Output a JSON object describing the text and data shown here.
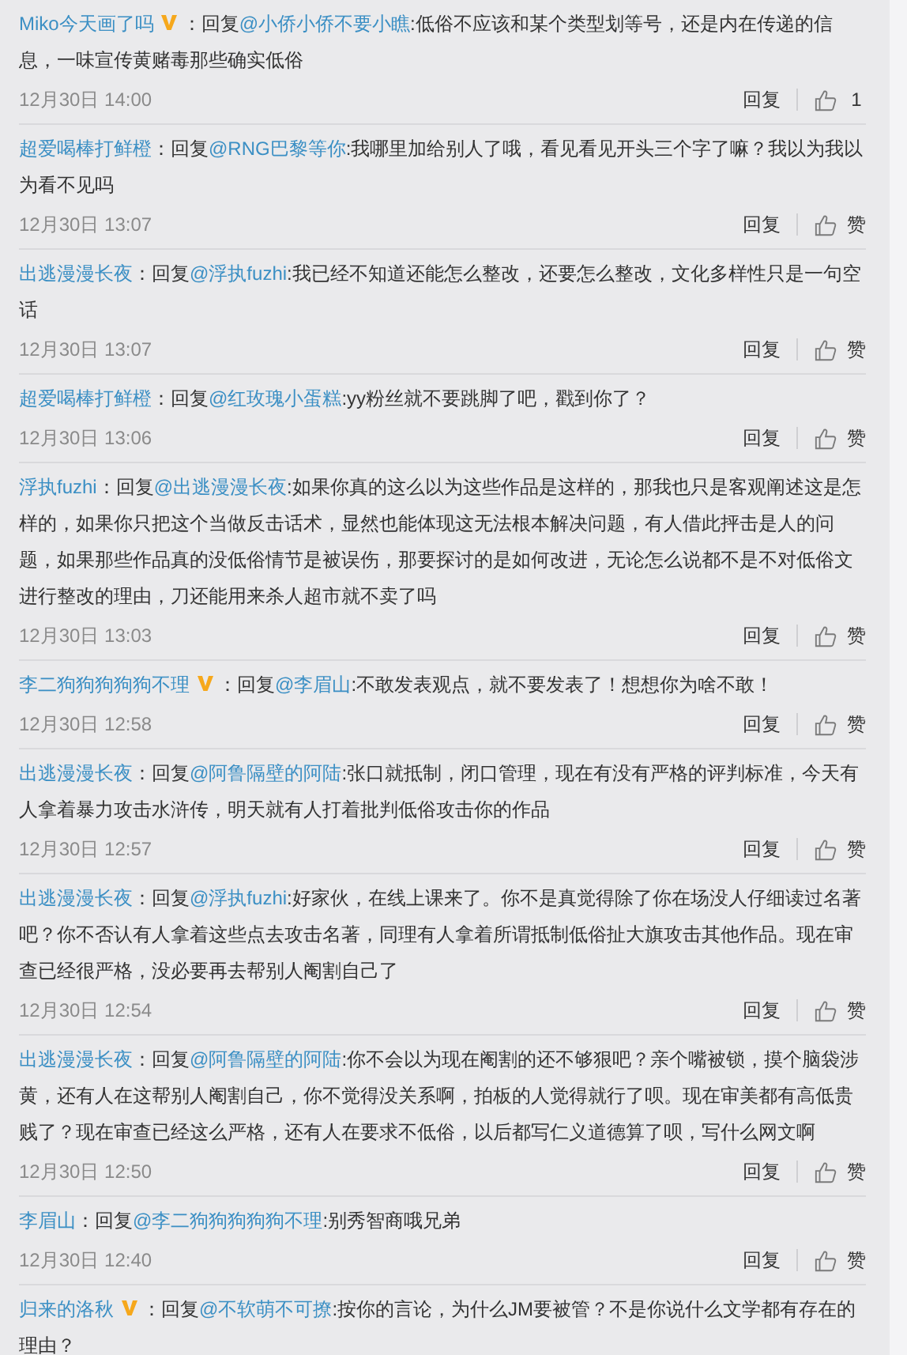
{
  "comments": [
    {
      "user": "Miko今天画了吗",
      "verified": true,
      "prefix": "：回复",
      "mention": "@小侨小侨不要小瞧",
      "text": ":低俗不应该和某个类型划等号，还是内在传递的信息，一味宣传黄赌毒那些确实低俗",
      "time": "12月30日 14:00",
      "reply": "回复",
      "like": "1"
    },
    {
      "user": "超爱喝棒打鲜橙",
      "verified": false,
      "prefix": "：回复",
      "mention": "@RNG巴黎等你",
      "text": ":我哪里加给别人了哦，看见看见开头三个字了嘛？我以为我以为看不见吗",
      "time": "12月30日 13:07",
      "reply": "回复",
      "like": "赞"
    },
    {
      "user": "出逃漫漫长夜",
      "verified": false,
      "prefix": "：回复",
      "mention": "@浮执fuzhi",
      "text": ":我已经不知道还能怎么整改，还要怎么整改，文化多样性只是一句空话",
      "time": "12月30日 13:07",
      "reply": "回复",
      "like": "赞"
    },
    {
      "user": "超爱喝棒打鲜橙",
      "verified": false,
      "prefix": "：回复",
      "mention": "@红玫瑰小蛋糕",
      "text": ":yy粉丝就不要跳脚了吧，戳到你了？",
      "time": "12月30日 13:06",
      "reply": "回复",
      "like": "赞"
    },
    {
      "user": "浮执fuzhi",
      "verified": false,
      "prefix": "：回复",
      "mention": "@出逃漫漫长夜",
      "text": ":如果你真的这么以为这些作品是这样的，那我也只是客观阐述这是怎样的，如果你只把这个当做反击话术，显然也能体现这无法根本解决问题，有人借此抨击是人的问题，如果那些作品真的没低俗情节是被误伤，那要探讨的是如何改进，无论怎么说都不是不对低俗文进行整改的理由，刀还能用来杀人超市就不卖了吗",
      "time": "12月30日 13:03",
      "reply": "回复",
      "like": "赞"
    },
    {
      "user": "李二狗狗狗狗狗不理",
      "verified": true,
      "prefix": "：回复",
      "mention": "@李眉山",
      "text": ":不敢发表观点，就不要发表了！想想你为啥不敢！",
      "time": "12月30日 12:58",
      "reply": "回复",
      "like": "赞"
    },
    {
      "user": "出逃漫漫长夜",
      "verified": false,
      "prefix": "：回复",
      "mention": "@阿鲁隔壁的阿陆",
      "text": ":张口就抵制，闭口管理，现在有没有严格的评判标准，今天有人拿着暴力攻击水浒传，明天就有人打着批判低俗攻击你的作品",
      "time": "12月30日 12:57",
      "reply": "回复",
      "like": "赞"
    },
    {
      "user": "出逃漫漫长夜",
      "verified": false,
      "prefix": "：回复",
      "mention": "@浮执fuzhi",
      "text": ":好家伙，在线上课来了。你不是真觉得除了你在场没人仔细读过名著吧？你不否认有人拿着这些点去攻击名著，同理有人拿着所谓抵制低俗扯大旗攻击其他作品。现在审查已经很严格，没必要再去帮别人阉割自己了",
      "time": "12月30日 12:54",
      "reply": "回复",
      "like": "赞"
    },
    {
      "user": "出逃漫漫长夜",
      "verified": false,
      "prefix": "：回复",
      "mention": "@阿鲁隔壁的阿陆",
      "text": ":你不会以为现在阉割的还不够狠吧？亲个嘴被锁，摸个脑袋涉黄，还有人在这帮别人阉割自己，你不觉得没关系啊，拍板的人觉得就行了呗。现在审美都有高低贵贱了？现在审查已经这么严格，还有人在要求不低俗，以后都写仁义道德算了呗，写什么网文啊",
      "time": "12月30日 12:50",
      "reply": "回复",
      "like": "赞"
    },
    {
      "user": "李眉山",
      "verified": false,
      "prefix": "：回复",
      "mention": "@李二狗狗狗狗狗不理",
      "text": ":别秀智商哦兄弟",
      "time": "12月30日 12:40",
      "reply": "回复",
      "like": "赞"
    },
    {
      "user": "归来的洛秋",
      "verified": true,
      "prefix": "：回复",
      "mention": "@不软萌不可撩",
      "text": ":按你的言论，为什么JM要被管？不是你说什么文学都有存在的理由？"
    }
  ]
}
